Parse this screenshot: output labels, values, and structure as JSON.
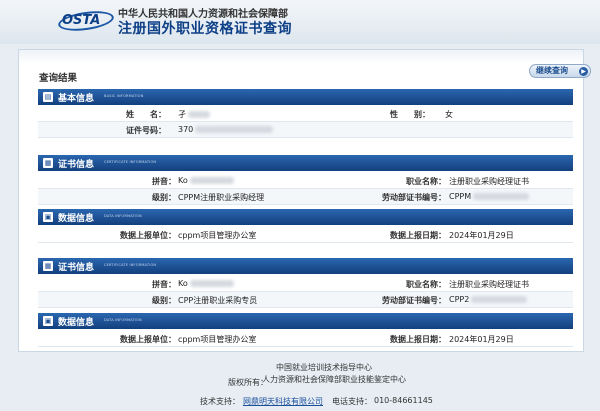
{
  "header": {
    "logo_text": "OSTA",
    "org": "中华人民共和国人力资源和社会保障部",
    "title": "注册国外职业资格证书查询"
  },
  "panel": {
    "result_title": "查询结果",
    "continue_label": "继续查询"
  },
  "basic": {
    "label": "基本信息",
    "en": "BASIC INFORMATION",
    "name_key": "姓　　名：",
    "name_val": "孑",
    "gender_key": "性　　别：",
    "gender_val": "女",
    "id_key": "证件号码：",
    "id_val": "370"
  },
  "cert1": {
    "label": "证书信息",
    "en": "CERTIFICATE INFORMATION",
    "pinyin_key": "拼音：",
    "pinyin_val": "Ko",
    "jobname_key": "职业名称：",
    "jobname_val": "注册职业采购经理证书",
    "level_key": "级别：",
    "level_val": "CPPM注册职业采购经理",
    "certno_key": "劳动部证书编号：",
    "certno_val": "CPPM"
  },
  "data1": {
    "label": "数据信息",
    "en": "DATA INFORMATION",
    "unit_key": "数据上报单位：",
    "unit_val": "cppm项目管理办公室",
    "date_key": "数据上报日期：",
    "date_val": "2024年01月29日"
  },
  "cert2": {
    "label": "证书信息",
    "en": "CERTIFICATE INFORMATION",
    "pinyin_key": "拼音：",
    "pinyin_val": "Ko",
    "jobname_key": "职业名称：",
    "jobname_val": "注册职业采购经理证书",
    "level_key": "级别：",
    "level_val": "CPP注册职业采购专员",
    "certno_key": "劳动部证书编号：",
    "certno_val": "CPP2"
  },
  "data2": {
    "label": "数据信息",
    "en": "DATA INFORMATION",
    "unit_key": "数据上报单位：",
    "unit_val": "cppm项目管理办公室",
    "date_key": "数据上报日期：",
    "date_val": "2024年01月29日"
  },
  "footer": {
    "copyright_key": "版权所有：",
    "owner1": "中国就业培训技术指导中心",
    "owner2": "人力资源和社会保障部职业技能鉴定中心",
    "tech_key": "技术支持：",
    "tech_val": "网鼎明天科技有限公司",
    "phone_key": "电话支持：",
    "phone_val": "010-84661145"
  },
  "colors": {
    "brand": "#0d3f86",
    "bar": "#1e4f93",
    "link": "#1b4f9c"
  }
}
